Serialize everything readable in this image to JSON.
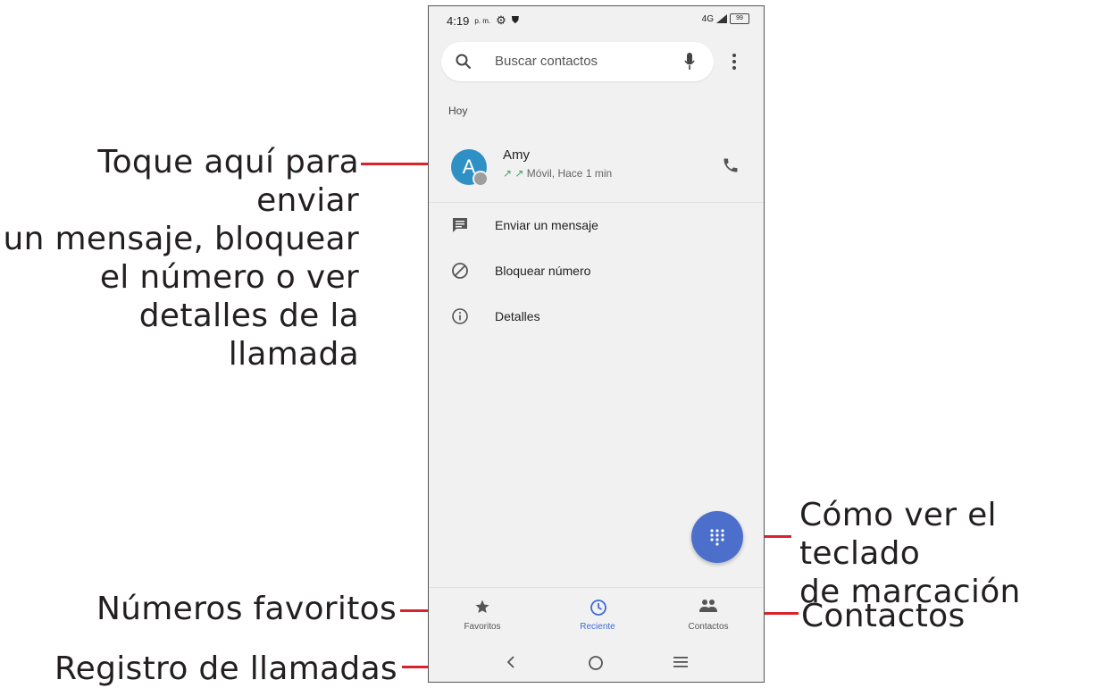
{
  "phone": {
    "status_bar": {
      "time": "4:19",
      "ampm": "p. m.",
      "network": "4G",
      "battery": "99"
    },
    "search": {
      "placeholder": "Buscar contactos"
    },
    "section_header": "Hoy",
    "call_entry": {
      "avatar_letter": "A",
      "name": "Amy",
      "detail": "Móvil, Hace 1 min",
      "arrows": "↗ ↗"
    },
    "actions": [
      {
        "label": "Enviar un mensaje",
        "icon": "message-icon"
      },
      {
        "label": "Bloquear número",
        "icon": "block-icon"
      },
      {
        "label": "Detalles",
        "icon": "info-icon"
      }
    ],
    "bottom_nav": [
      {
        "label": "Favoritos",
        "icon": "star-icon",
        "active": false
      },
      {
        "label": "Reciente",
        "icon": "clock-icon",
        "active": true
      },
      {
        "label": "Contactos",
        "icon": "people-icon",
        "active": false
      }
    ],
    "fab_icon": "dialpad-icon"
  },
  "callouts": {
    "entry_menu": [
      "Toque aquí para enviar",
      "un mensaje, bloquear",
      "el número o ver",
      "detalles de la llamada"
    ],
    "dialpad": [
      "Cómo ver el teclado",
      "de marcación"
    ],
    "favorites": "Números favoritos",
    "contacts": "Contactos",
    "call_log": "Registro de llamadas"
  },
  "colors": {
    "accent": "#3f6ad8",
    "fab": "#4c6fcc",
    "avatar": "#2f90c6",
    "callout_line": "#d9222a"
  }
}
